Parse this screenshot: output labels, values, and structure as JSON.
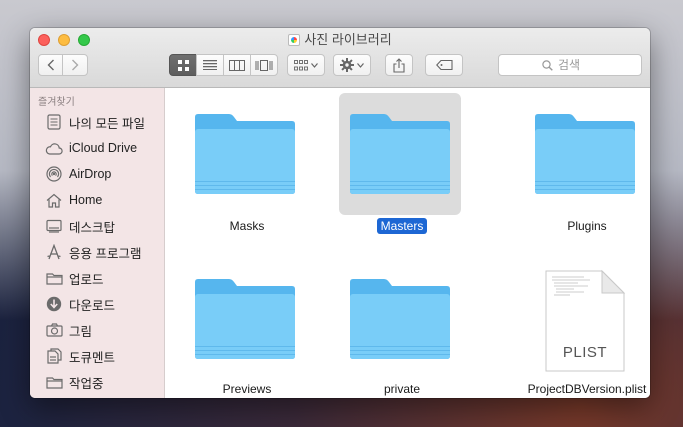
{
  "window": {
    "title": "사진 라이브러리"
  },
  "toolbar": {
    "back_icon": "chevron-left-icon",
    "forward_icon": "chevron-right-icon",
    "view_modes": [
      "icon-view-icon",
      "list-view-icon",
      "column-view-icon",
      "cover-flow-icon"
    ],
    "active_view": 0,
    "group_icon": "arrange-grid-icon",
    "action_icon": "gear-icon",
    "share_icon": "share-icon",
    "tag_icon": "tag-icon",
    "search": {
      "placeholder": "검색"
    }
  },
  "sidebar": {
    "header": "즐겨찾기",
    "items": [
      {
        "label": "나의 모든 파일",
        "icon": "all-files-icon"
      },
      {
        "label": "iCloud Drive",
        "icon": "cloud-icon"
      },
      {
        "label": "AirDrop",
        "icon": "airdrop-icon"
      },
      {
        "label": "Home",
        "icon": "home-icon"
      },
      {
        "label": "데스크탑",
        "icon": "desktop-icon"
      },
      {
        "label": "응용 프로그램",
        "icon": "applications-icon"
      },
      {
        "label": "업로드",
        "icon": "folder-icon"
      },
      {
        "label": "다운로드",
        "icon": "download-icon"
      },
      {
        "label": "그림",
        "icon": "camera-icon"
      },
      {
        "label": "도큐멘트",
        "icon": "documents-icon"
      },
      {
        "label": "작업중",
        "icon": "folder-icon"
      }
    ]
  },
  "files": [
    {
      "name": "Masks",
      "kind": "folder",
      "selected": false
    },
    {
      "name": "Masters",
      "kind": "folder",
      "selected": true
    },
    {
      "name": "Plugins",
      "kind": "folder",
      "selected": false
    },
    {
      "name": "Previews",
      "kind": "folder",
      "selected": false
    },
    {
      "name": "private",
      "kind": "folder",
      "selected": false
    },
    {
      "name": "ProjectDBVersion.plist",
      "kind": "plist",
      "doc_label": "PLIST",
      "selected": false
    }
  ],
  "colors": {
    "selection": "#1d67d4",
    "folder": "#6cc4f6",
    "sidebar_bg": "#f3e5e6"
  }
}
